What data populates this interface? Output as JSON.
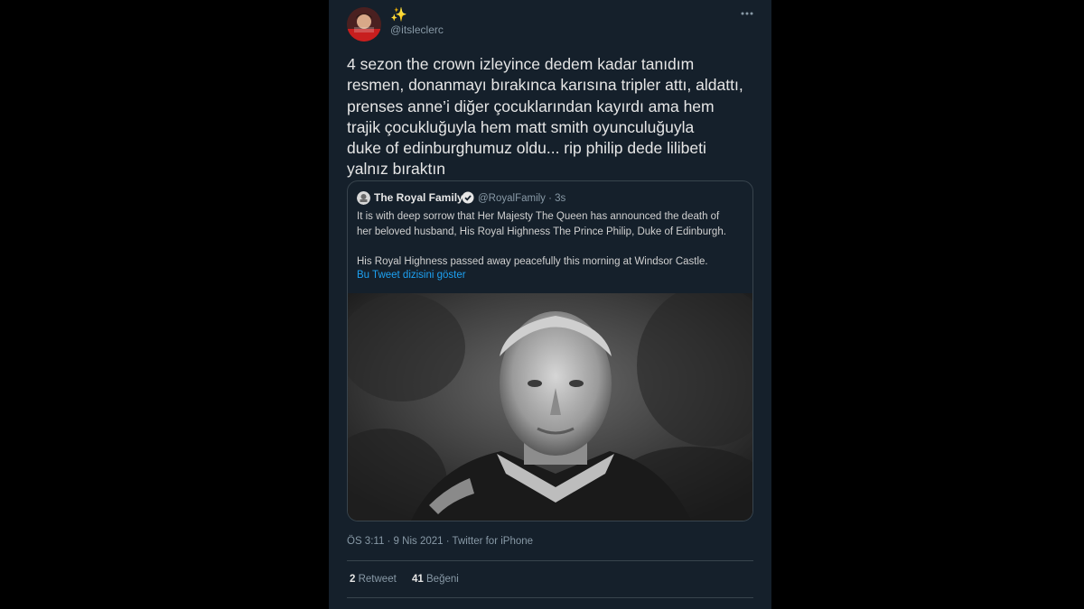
{
  "author": {
    "display_name": "✨",
    "handle": "@itsleclerc",
    "avatar_icon": "avatar-photo"
  },
  "tweet": {
    "text": "4 sezon the crown izleyince dedem kadar tanıdım\nresmen, donanmayı bırakınca karısına tripler attı, aldattı,\nprenses anne’i diğer çocuklarından kayırdı ama hem\ntrajik çocukluğuyla hem matt smith oyunculuğuyla\nduke of edinburghumuz oldu... rip philip dede lilibeti\nyalnız bıraktın",
    "timestamp": "ÖS 3:11 · 9 Nis 2021 · Twitter for iPhone"
  },
  "quote": {
    "name": "The Royal Family",
    "handle_time": "@RoyalFamily · 3s",
    "text": "It is with deep sorrow that Her Majesty The Queen has announced the death of\nher beloved husband, His Royal Highness The Prince Philip, Duke of Edinburgh.\n\nHis Royal Highness passed away peacefully this morning at Windsor Castle.",
    "thread_link": "Bu Tweet dizisini göster"
  },
  "stats": {
    "retweet_count": "2",
    "retweet_label": "Retweet",
    "like_count": "41",
    "like_label": "Beğeni"
  },
  "colors": {
    "page_background": "#000000",
    "column_background": "#15202b",
    "border": "#38444d",
    "secondary_text": "#8899a6",
    "link": "#1da1f2"
  }
}
